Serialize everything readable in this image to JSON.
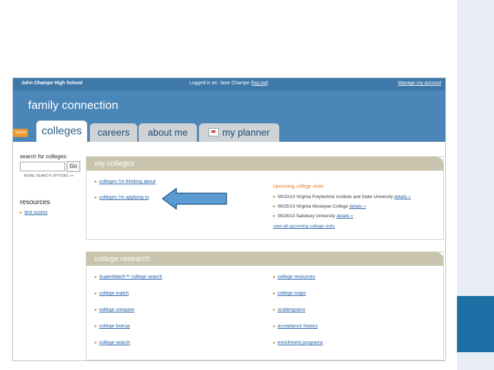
{
  "topbar": {
    "school": "John Champe High School",
    "logged_in": "Logged in as: Jane Champe (",
    "logout": "log out",
    "logged_close": ")",
    "manage": "Manage my account"
  },
  "brand": "family connection",
  "home_tab": "home",
  "tabs": [
    {
      "label": "colleges",
      "active": true
    },
    {
      "label": "careers",
      "active": false
    },
    {
      "label": "about me",
      "active": false
    },
    {
      "label": "my planner",
      "active": false
    }
  ],
  "search": {
    "label": "search for colleges:",
    "value": "",
    "go": "Go",
    "more": "MORE SEARCH OPTIONS >>"
  },
  "resources": {
    "title": "resources",
    "items": [
      "test scores"
    ]
  },
  "my_colleges": {
    "title": "my colleges",
    "links": [
      "colleges I'm thinking about",
      "colleges I'm applying to"
    ],
    "upcoming": {
      "title": "Upcoming college visits",
      "visits": [
        {
          "text": "09/10/13 Virginia Polytechnic Institute and State University",
          "details": "details »"
        },
        {
          "text": "09/25/13 Virginia Wesleyan College",
          "details": "details »"
        },
        {
          "text": "09/28/13 Salisbury University",
          "details": "details »"
        }
      ],
      "view_all": "view all upcoming college visits"
    }
  },
  "college_research": {
    "title": "college research",
    "left": [
      "SuperMatch™ college search",
      "college match",
      "college compare",
      "college lookup",
      "college search"
    ],
    "right": [
      "college resources",
      "college maps",
      "scattergrams",
      "acceptance history",
      "enrichment programs"
    ]
  },
  "colors": {
    "header": "#4a86b8",
    "topbar": "#3e78a8",
    "panel_title": "#c9c4ad",
    "link": "#2460a7",
    "accent": "#f19a2a",
    "arrow": "#5b9bd5"
  },
  "icons": [
    "arrow-left-icon",
    "planner-icon",
    "bullet-icon"
  ]
}
